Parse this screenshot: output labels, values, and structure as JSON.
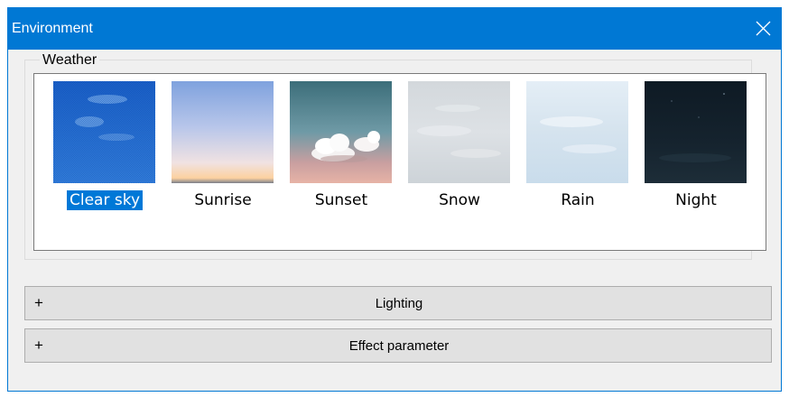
{
  "window": {
    "title": "Environment",
    "close_glyph": "✕",
    "accent_color": "#0078d4"
  },
  "weather": {
    "group_label": "Weather",
    "selected": "Clear sky",
    "items": [
      {
        "label": "Clear sky",
        "icon": "clear-sky-thumbnail"
      },
      {
        "label": "Sunrise",
        "icon": "sunrise-thumbnail"
      },
      {
        "label": "Sunset",
        "icon": "sunset-thumbnail"
      },
      {
        "label": "Snow",
        "icon": "snow-thumbnail"
      },
      {
        "label": "Rain",
        "icon": "rain-thumbnail"
      },
      {
        "label": "Night",
        "icon": "night-thumbnail"
      }
    ]
  },
  "sections": {
    "lighting": {
      "expander": "+",
      "label": "Lighting"
    },
    "effect": {
      "expander": "+",
      "label": "Effect parameter"
    }
  }
}
